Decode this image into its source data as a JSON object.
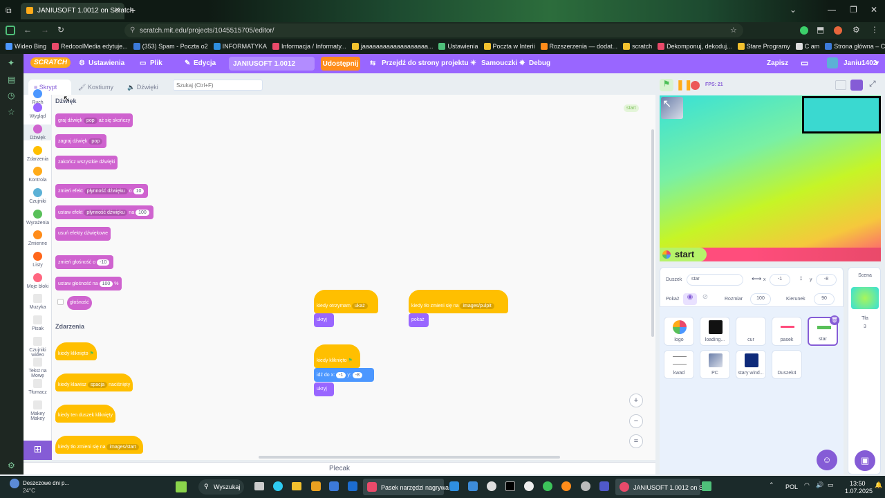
{
  "browser": {
    "tab_title": "JANIUSOFT 1.0012 on Scratch",
    "url": "scratch.mit.edu/projects/1045515705/editor/",
    "bookmarks": [
      "Wideo Bing",
      "RedcoolMedia edytuje...",
      "(353) Spam - Poczta o2",
      "INFORMATYKA",
      "Informacja / Informaty...",
      "jaaaaaaaaaaaaaaaaaaa...",
      "Ustawienia",
      "Poczta w Interii",
      "Rozszerzenia — dodat...",
      "scratch",
      "Dekomponuj, dekoduj...",
      "Stare Programy",
      "C am",
      "Strona główna – Canva",
      "Finish setup"
    ]
  },
  "menubar": {
    "logo": "SCRATCH",
    "settings": "Ustawienia",
    "file": "Plik",
    "edit": "Edycja",
    "project_title": "JANIUSOFT 1.0012",
    "share": "Udostępnij",
    "see_project": "Przejdź do strony projektu",
    "tutorials": "Samouczki",
    "debug": "Debug",
    "save": "Zapisz",
    "user": "Janiu1402"
  },
  "tabs": {
    "code": "Skrypt",
    "costumes": "Kostiumy",
    "sounds": "Dźwięki"
  },
  "search_placeholder": "Szukaj (Ctrl+F)",
  "categories": [
    {
      "label": "Ruch",
      "color": "#4c97ff"
    },
    {
      "label": "Wygląd",
      "color": "#9966ff"
    },
    {
      "label": "Dźwięk",
      "color": "#cf63cf"
    },
    {
      "label": "Zdarzenia",
      "color": "#ffbf00"
    },
    {
      "label": "Kontrola",
      "color": "#ffab19"
    },
    {
      "label": "Czujniki",
      "color": "#5cb1d6"
    },
    {
      "label": "Wyrażenia",
      "color": "#59c059"
    },
    {
      "label": "Zmienne",
      "color": "#ff8c1a"
    },
    {
      "label": "Listy",
      "color": "#ff661a"
    },
    {
      "label": "Moje bloki",
      "color": "#ff6680"
    },
    {
      "label": "Muzyka"
    },
    {
      "label": "Pisak"
    },
    {
      "label": "Czujniki wideo"
    },
    {
      "label": "Tekst na Mowę"
    },
    {
      "label": "Tłumacz"
    },
    {
      "label": "Makey Makey"
    }
  ],
  "palette": {
    "sound_heading": "Dźwięk",
    "play_until_done": "graj dźwięk",
    "play_until_done_dd": "pop",
    "play_until_done_tail": "aż się skończy",
    "start_sound": "zagraj dźwięk",
    "start_sound_dd": "pop",
    "stop_all_sounds": "zakończ wszystkie dźwięki",
    "change_effect": "zmień efekt",
    "change_effect_dd": "płynność dźwięku",
    "change_effect_by": "o",
    "change_effect_val": "10",
    "set_effect": "ustaw efekt",
    "set_effect_dd": "płynność dźwięku",
    "set_effect_to": "na",
    "set_effect_val": "100",
    "clear_effects": "usuń efekty dźwiękowe",
    "change_volume": "zmień głośność o",
    "change_volume_val": "-10",
    "set_volume": "ustaw głośność na",
    "set_volume_val": "100",
    "set_volume_unit": "%",
    "volume_reporter": "głośność",
    "events_heading": "Zdarzenia",
    "when_flag": "kiedy kliknięto",
    "when_key": "kiedy klawisz",
    "when_key_dd": "spacja",
    "when_key_tail": "naciśnięty",
    "when_sprite_clicked": "kiedy ten duszek kliknięty",
    "when_backdrop": "kiedy tło zmieni się na",
    "when_backdrop_dd": "images/start"
  },
  "workspace": {
    "sprite_tag": "start",
    "script1_hat": "kiedy otrzymam",
    "script1_dd": "ukaż",
    "script1_body": "ukryj",
    "script2_hat": "kiedy tło zmieni się na",
    "script2_dd": "images/pulpit",
    "script2_body": "pokaż",
    "script3_hat": "kiedy kliknięto",
    "script3_goto": "idź do x:",
    "script3_x": "-1",
    "script3_y_label": "y:",
    "script3_y": "-8",
    "script3_hide": "ukryj"
  },
  "stage": {
    "fps": "FPS: 21",
    "start_label": "start"
  },
  "sprite_info": {
    "sprite_label": "Duszek",
    "sprite_name": "star",
    "x_label": "x",
    "x": "-1",
    "y_label": "y",
    "y": "-8",
    "show_label": "Pokaż",
    "size_label": "Rozmiar",
    "size": "100",
    "direction_label": "Kierunek",
    "direction": "90"
  },
  "sprites": [
    {
      "name": "logo"
    },
    {
      "name": "loading..."
    },
    {
      "name": "cur"
    },
    {
      "name": "pasek"
    },
    {
      "name": "star",
      "selected": true
    },
    {
      "name": "kwad"
    },
    {
      "name": "PC"
    },
    {
      "name": "stary wind..."
    },
    {
      "name": "Duszek4"
    }
  ],
  "scene": {
    "label": "Scena",
    "backdrops_label": "Tła",
    "backdrops_count": "3"
  },
  "backpack": "Plecak",
  "taskbar": {
    "weather_title": "Deszczowe dni p...",
    "weather_temp": "24°C",
    "search": "Wyszukaj",
    "app_title": "Pasek narzędzi nagrywa",
    "browser_title": "JANIUSOFT 1.0012 on Sc",
    "lang": "POL",
    "time": "13:50",
    "date": "1.07.2025"
  }
}
